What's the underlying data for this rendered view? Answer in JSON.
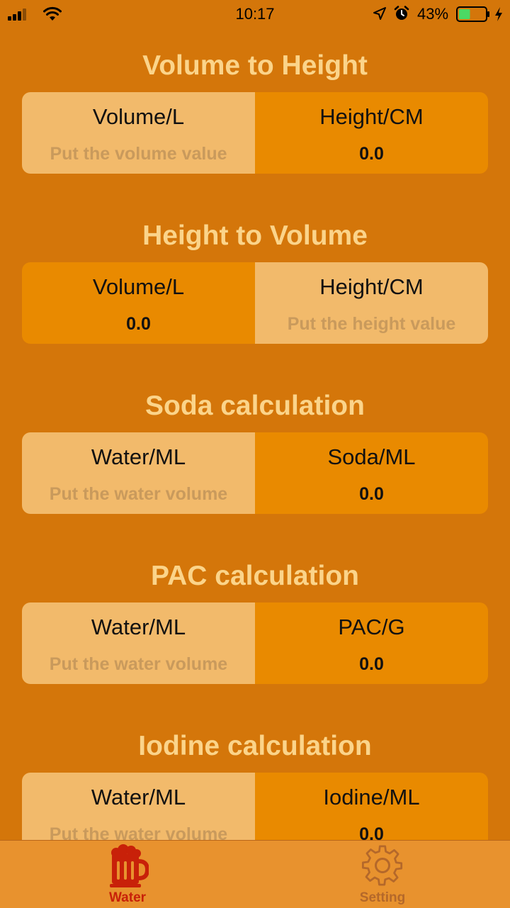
{
  "status_bar": {
    "time": "10:17",
    "battery_percent": "43%",
    "battery_level": 0.43
  },
  "sections": [
    {
      "title": "Volume to Height",
      "left": {
        "kind": "input",
        "label": "Volume/L",
        "placeholder": "Put the volume value"
      },
      "right": {
        "kind": "output",
        "label": "Height/CM",
        "value": "0.0"
      }
    },
    {
      "title": "Height to Volume",
      "left": {
        "kind": "output",
        "label": "Volume/L",
        "value": "0.0"
      },
      "right": {
        "kind": "input",
        "label": "Height/CM",
        "placeholder": "Put the height value"
      }
    },
    {
      "title": "Soda calculation",
      "left": {
        "kind": "input",
        "label": "Water/ML",
        "placeholder": "Put the water volume"
      },
      "right": {
        "kind": "output",
        "label": "Soda/ML",
        "value": "0.0"
      }
    },
    {
      "title": "PAC calculation",
      "left": {
        "kind": "input",
        "label": "Water/ML",
        "placeholder": "Put the water volume"
      },
      "right": {
        "kind": "output",
        "label": "PAC/G",
        "value": "0.0"
      }
    },
    {
      "title": "Iodine calculation",
      "left": {
        "kind": "input",
        "label": "Water/ML",
        "placeholder": "Put the water volume"
      },
      "right": {
        "kind": "output",
        "label": "Iodine/ML",
        "value": "0.0"
      }
    }
  ],
  "tab_bar": {
    "tabs": [
      {
        "label": "Water",
        "icon": "beer-mug-icon",
        "active": true
      },
      {
        "label": "Setting",
        "icon": "gear-icon",
        "active": false
      }
    ]
  },
  "colors": {
    "background": "#d4760a",
    "title": "#fbd48a",
    "input_bg": "#f2ba6b",
    "output_bg": "#e98a00",
    "tab_active": "#c82109",
    "tab_inactive": "#b4682a",
    "battery_fill": "#4cd964"
  }
}
